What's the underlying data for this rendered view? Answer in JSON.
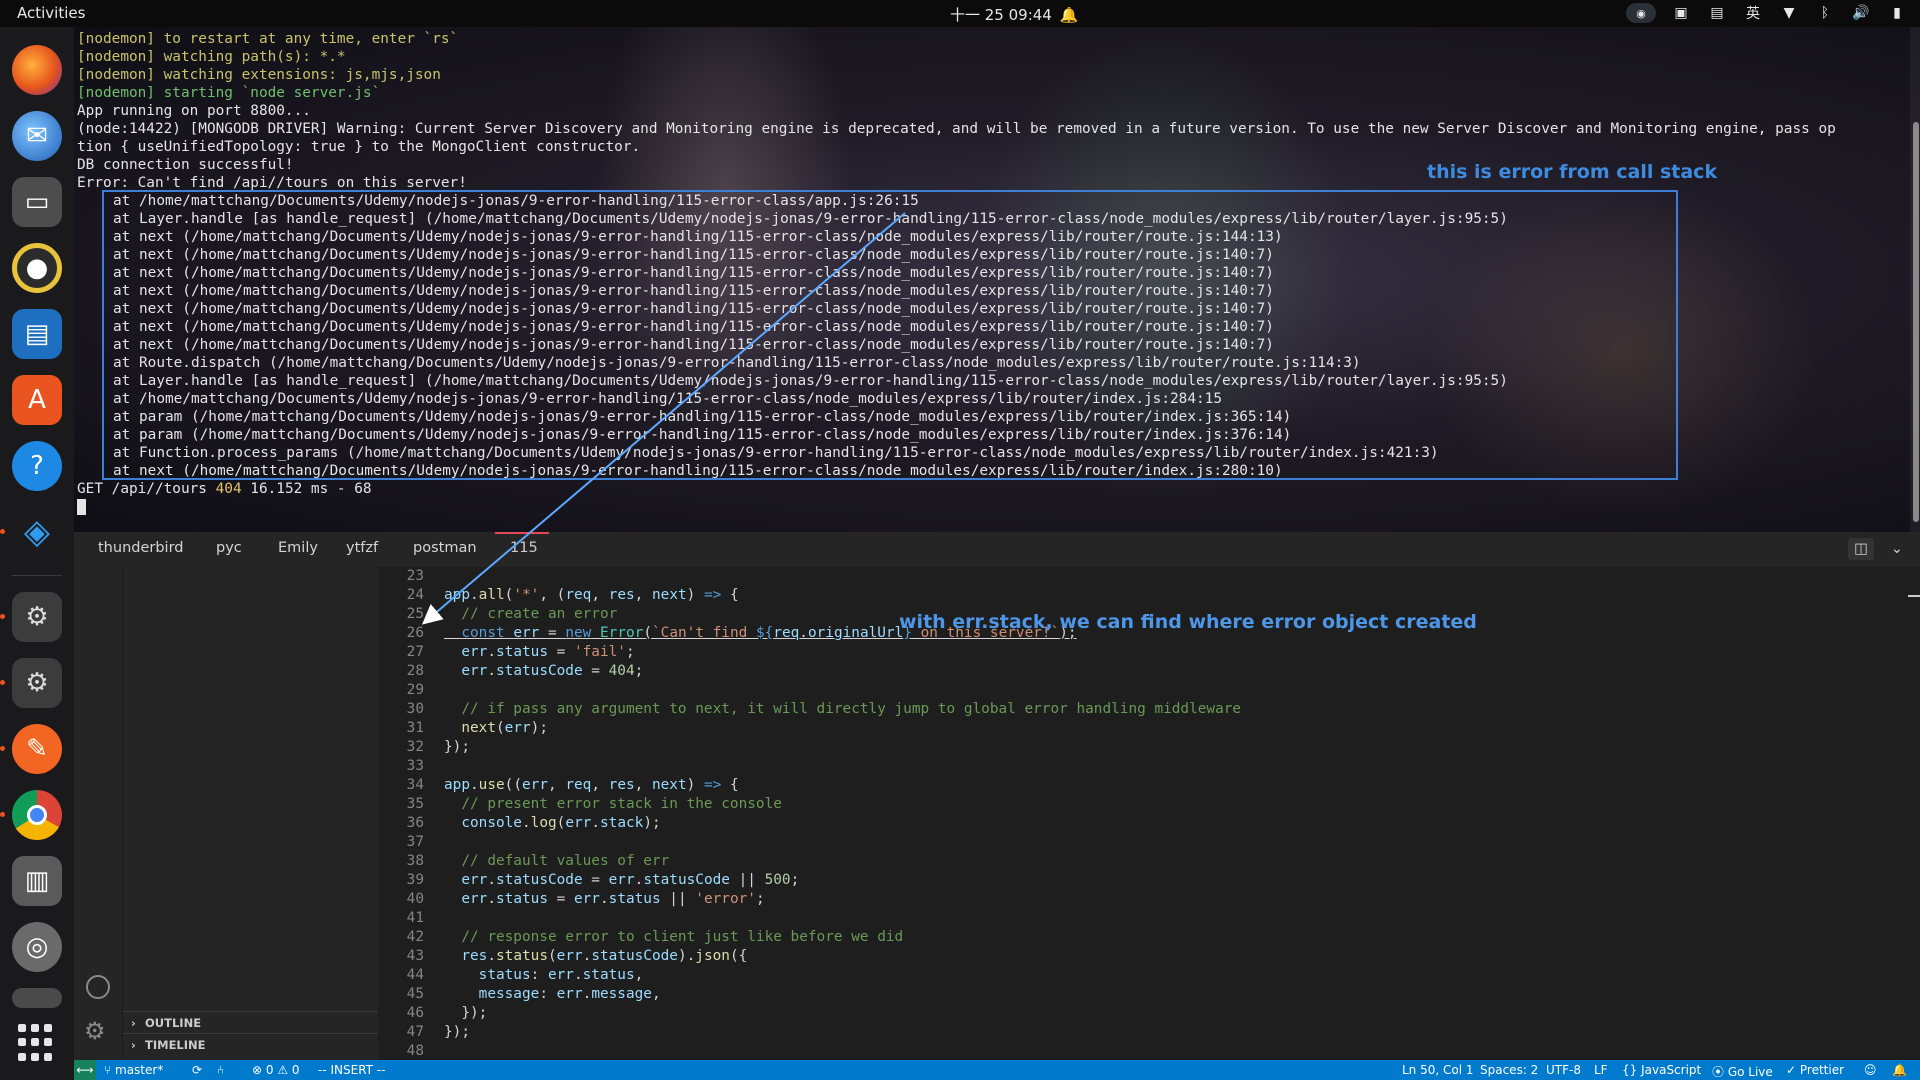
{
  "topbar": {
    "activities": "Activities",
    "clock": "十一 25  09:44",
    "ime": "英"
  },
  "terminal": {
    "lines": [
      {
        "text": "[nodemon] to restart at any time, enter `rs`",
        "kind": "nodemon"
      },
      {
        "text": "[nodemon] watching path(s): *.*",
        "kind": "nodemon"
      },
      {
        "text": "[nodemon] watching extensions: js,mjs,json",
        "kind": "nodemon"
      },
      {
        "text": "[nodemon] starting `node server.js`",
        "kind": "nodemon-green"
      },
      {
        "text": "App running on port 8800...",
        "kind": "plain"
      },
      {
        "text": "(node:14422) [MONGODB DRIVER] Warning: Current Server Discovery and Monitoring engine is deprecated, and will be removed in a future version. To use the new Server Discover and Monitoring engine, pass op",
        "kind": "plain"
      },
      {
        "text": "tion { useUnifiedTopology: true } to the MongoClient constructor.",
        "kind": "plain"
      },
      {
        "text": "DB connection successful!",
        "kind": "plain"
      },
      {
        "text": "Error: Can't find /api//tours on this server!",
        "kind": "plain"
      },
      {
        "text": "at /home/mattchang/Documents/Udemy/nodejs-jonas/9-error-handling/115-error-class/app.js:26:15",
        "kind": "stack"
      },
      {
        "text": "at Layer.handle [as handle_request] (/home/mattchang/Documents/Udemy/nodejs-jonas/9-error-handling/115-error-class/node_modules/express/lib/router/layer.js:95:5)",
        "kind": "stack"
      },
      {
        "text": "at next (/home/mattchang/Documents/Udemy/nodejs-jonas/9-error-handling/115-error-class/node_modules/express/lib/router/route.js:144:13)",
        "kind": "stack"
      },
      {
        "text": "at next (/home/mattchang/Documents/Udemy/nodejs-jonas/9-error-handling/115-error-class/node_modules/express/lib/router/route.js:140:7)",
        "kind": "stack"
      },
      {
        "text": "at next (/home/mattchang/Documents/Udemy/nodejs-jonas/9-error-handling/115-error-class/node_modules/express/lib/router/route.js:140:7)",
        "kind": "stack"
      },
      {
        "text": "at next (/home/mattchang/Documents/Udemy/nodejs-jonas/9-error-handling/115-error-class/node_modules/express/lib/router/route.js:140:7)",
        "kind": "stack"
      },
      {
        "text": "at next (/home/mattchang/Documents/Udemy/nodejs-jonas/9-error-handling/115-error-class/node_modules/express/lib/router/route.js:140:7)",
        "kind": "stack"
      },
      {
        "text": "at next (/home/mattchang/Documents/Udemy/nodejs-jonas/9-error-handling/115-error-class/node_modules/express/lib/router/route.js:140:7)",
        "kind": "stack"
      },
      {
        "text": "at next (/home/mattchang/Documents/Udemy/nodejs-jonas/9-error-handling/115-error-class/node_modules/express/lib/router/route.js:140:7)",
        "kind": "stack"
      },
      {
        "text": "at Route.dispatch (/home/mattchang/Documents/Udemy/nodejs-jonas/9-error-handling/115-error-class/node_modules/express/lib/router/route.js:114:3)",
        "kind": "stack"
      },
      {
        "text": "at Layer.handle [as handle_request] (/home/mattchang/Documents/Udemy/nodejs-jonas/9-error-handling/115-error-class/node_modules/express/lib/router/layer.js:95:5)",
        "kind": "stack"
      },
      {
        "text": "at /home/mattchang/Documents/Udemy/nodejs-jonas/9-error-handling/115-error-class/node_modules/express/lib/router/index.js:284:15",
        "kind": "stack"
      },
      {
        "text": "at param (/home/mattchang/Documents/Udemy/nodejs-jonas/9-error-handling/115-error-class/node_modules/express/lib/router/index.js:365:14)",
        "kind": "stack"
      },
      {
        "text": "at param (/home/mattchang/Documents/Udemy/nodejs-jonas/9-error-handling/115-error-class/node_modules/express/lib/router/index.js:376:14)",
        "kind": "stack"
      },
      {
        "text": "at Function.process_params (/home/mattchang/Documents/Udemy/nodejs-jonas/9-error-handling/115-error-class/node_modules/express/lib/router/index.js:421:3)",
        "kind": "stack"
      },
      {
        "text": "at next (/home/mattchang/Documents/Udemy/nodejs-jonas/9-error-handling/115-error-class/node_modules/express/lib/router/index.js:280:10)",
        "kind": "stack"
      }
    ],
    "request_log": {
      "prefix": "GET /api//tours ",
      "status": "404",
      "suffix": " 16.152 ms - 68"
    },
    "annotation": "this is error from call stack"
  },
  "vscode": {
    "tabs": [
      "thunderbird",
      "pyc",
      "Emily",
      "ytfzf",
      "postman",
      "115"
    ],
    "active_tab": "115",
    "sidebar_sections": [
      "OUTLINE",
      "TIMELINE"
    ],
    "annotation": "with err.stack, we can find where error object created",
    "code": [
      {
        "n": "23",
        "html": ""
      },
      {
        "n": "24",
        "html": "<span class='var'>app</span>.<span class='fn'>all</span>(<span class='str'>'*'</span>, (<span class='var'>req</span>, <span class='var'>res</span>, <span class='var'>next</span>) <span class='kw'>=&gt;</span> {"
      },
      {
        "n": "25",
        "html": "  <span class='cm'>// create an error</span>"
      },
      {
        "n": "26",
        "html": "  <span class='kw'>const</span> <span class='var'>err</span> = <span class='kw'>new</span> <span class='cls'>Error</span>(<span class='str'>`Can't find </span><span class='kw'>${</span><span class='var'>req</span>.<span class='var'>originalUrl</span><span class='kw'>}</span><span class='str'> on this server!`</span>);",
        "underline": true
      },
      {
        "n": "27",
        "html": "  <span class='var'>err</span>.<span class='var'>status</span> = <span class='str'>'fail'</span>;"
      },
      {
        "n": "28",
        "html": "  <span class='var'>err</span>.<span class='var'>statusCode</span> = <span class='num'>404</span>;"
      },
      {
        "n": "29",
        "html": ""
      },
      {
        "n": "30",
        "html": "  <span class='cm'>// if pass any argument to next, it will directly jump to global error handling middleware</span>"
      },
      {
        "n": "31",
        "html": "  <span class='fn'>next</span>(<span class='var'>err</span>);"
      },
      {
        "n": "32",
        "html": "});"
      },
      {
        "n": "33",
        "html": ""
      },
      {
        "n": "34",
        "html": "<span class='var'>app</span>.<span class='fn'>use</span>((<span class='var'>err</span>, <span class='var'>req</span>, <span class='var'>res</span>, <span class='var'>next</span>) <span class='kw'>=&gt;</span> {"
      },
      {
        "n": "35",
        "html": "  <span class='cm'>// present error stack in the console</span>"
      },
      {
        "n": "36",
        "html": "  <span class='var'>console</span>.<span class='fn'>log</span>(<span class='var'>err</span>.<span class='var'>stack</span>);"
      },
      {
        "n": "37",
        "html": ""
      },
      {
        "n": "38",
        "html": "  <span class='cm'>// default values of err</span>"
      },
      {
        "n": "39",
        "html": "  <span class='var'>err</span>.<span class='var'>statusCode</span> = <span class='var'>err</span>.<span class='var'>statusCode</span> || <span class='num'>500</span>;"
      },
      {
        "n": "40",
        "html": "  <span class='var'>err</span>.<span class='var'>status</span> = <span class='var'>err</span>.<span class='var'>status</span> || <span class='str'>'error'</span>;"
      },
      {
        "n": "41",
        "html": ""
      },
      {
        "n": "42",
        "html": "  <span class='cm'>// response error to client just like before we did</span>"
      },
      {
        "n": "43",
        "html": "  <span class='var'>res</span>.<span class='fn'>status</span>(<span class='var'>err</span>.<span class='var'>statusCode</span>).<span class='fn'>json</span>({"
      },
      {
        "n": "44",
        "html": "    <span class='var'>status</span>: <span class='var'>err</span>.<span class='var'>status</span>,"
      },
      {
        "n": "45",
        "html": "    <span class='var'>message</span>: <span class='var'>err</span>.<span class='var'>message</span>,"
      },
      {
        "n": "46",
        "html": "  });"
      },
      {
        "n": "47",
        "html": "});"
      },
      {
        "n": "48",
        "html": ""
      }
    ]
  },
  "statusbar": {
    "branch": "master*",
    "problems": "⊗ 0 ⚠ 0",
    "mode": "-- INSERT --",
    "position": "Ln 50, Col 1",
    "spaces": "Spaces: 2",
    "encoding": "UTF-8",
    "eol": "LF",
    "language": "JavaScript",
    "golive": "Go Live",
    "prettier": "Prettier"
  },
  "colors": {
    "annotation_blue": "#3d7fd6",
    "statusbar": "#007acc",
    "tab_accent": "#e74856"
  }
}
